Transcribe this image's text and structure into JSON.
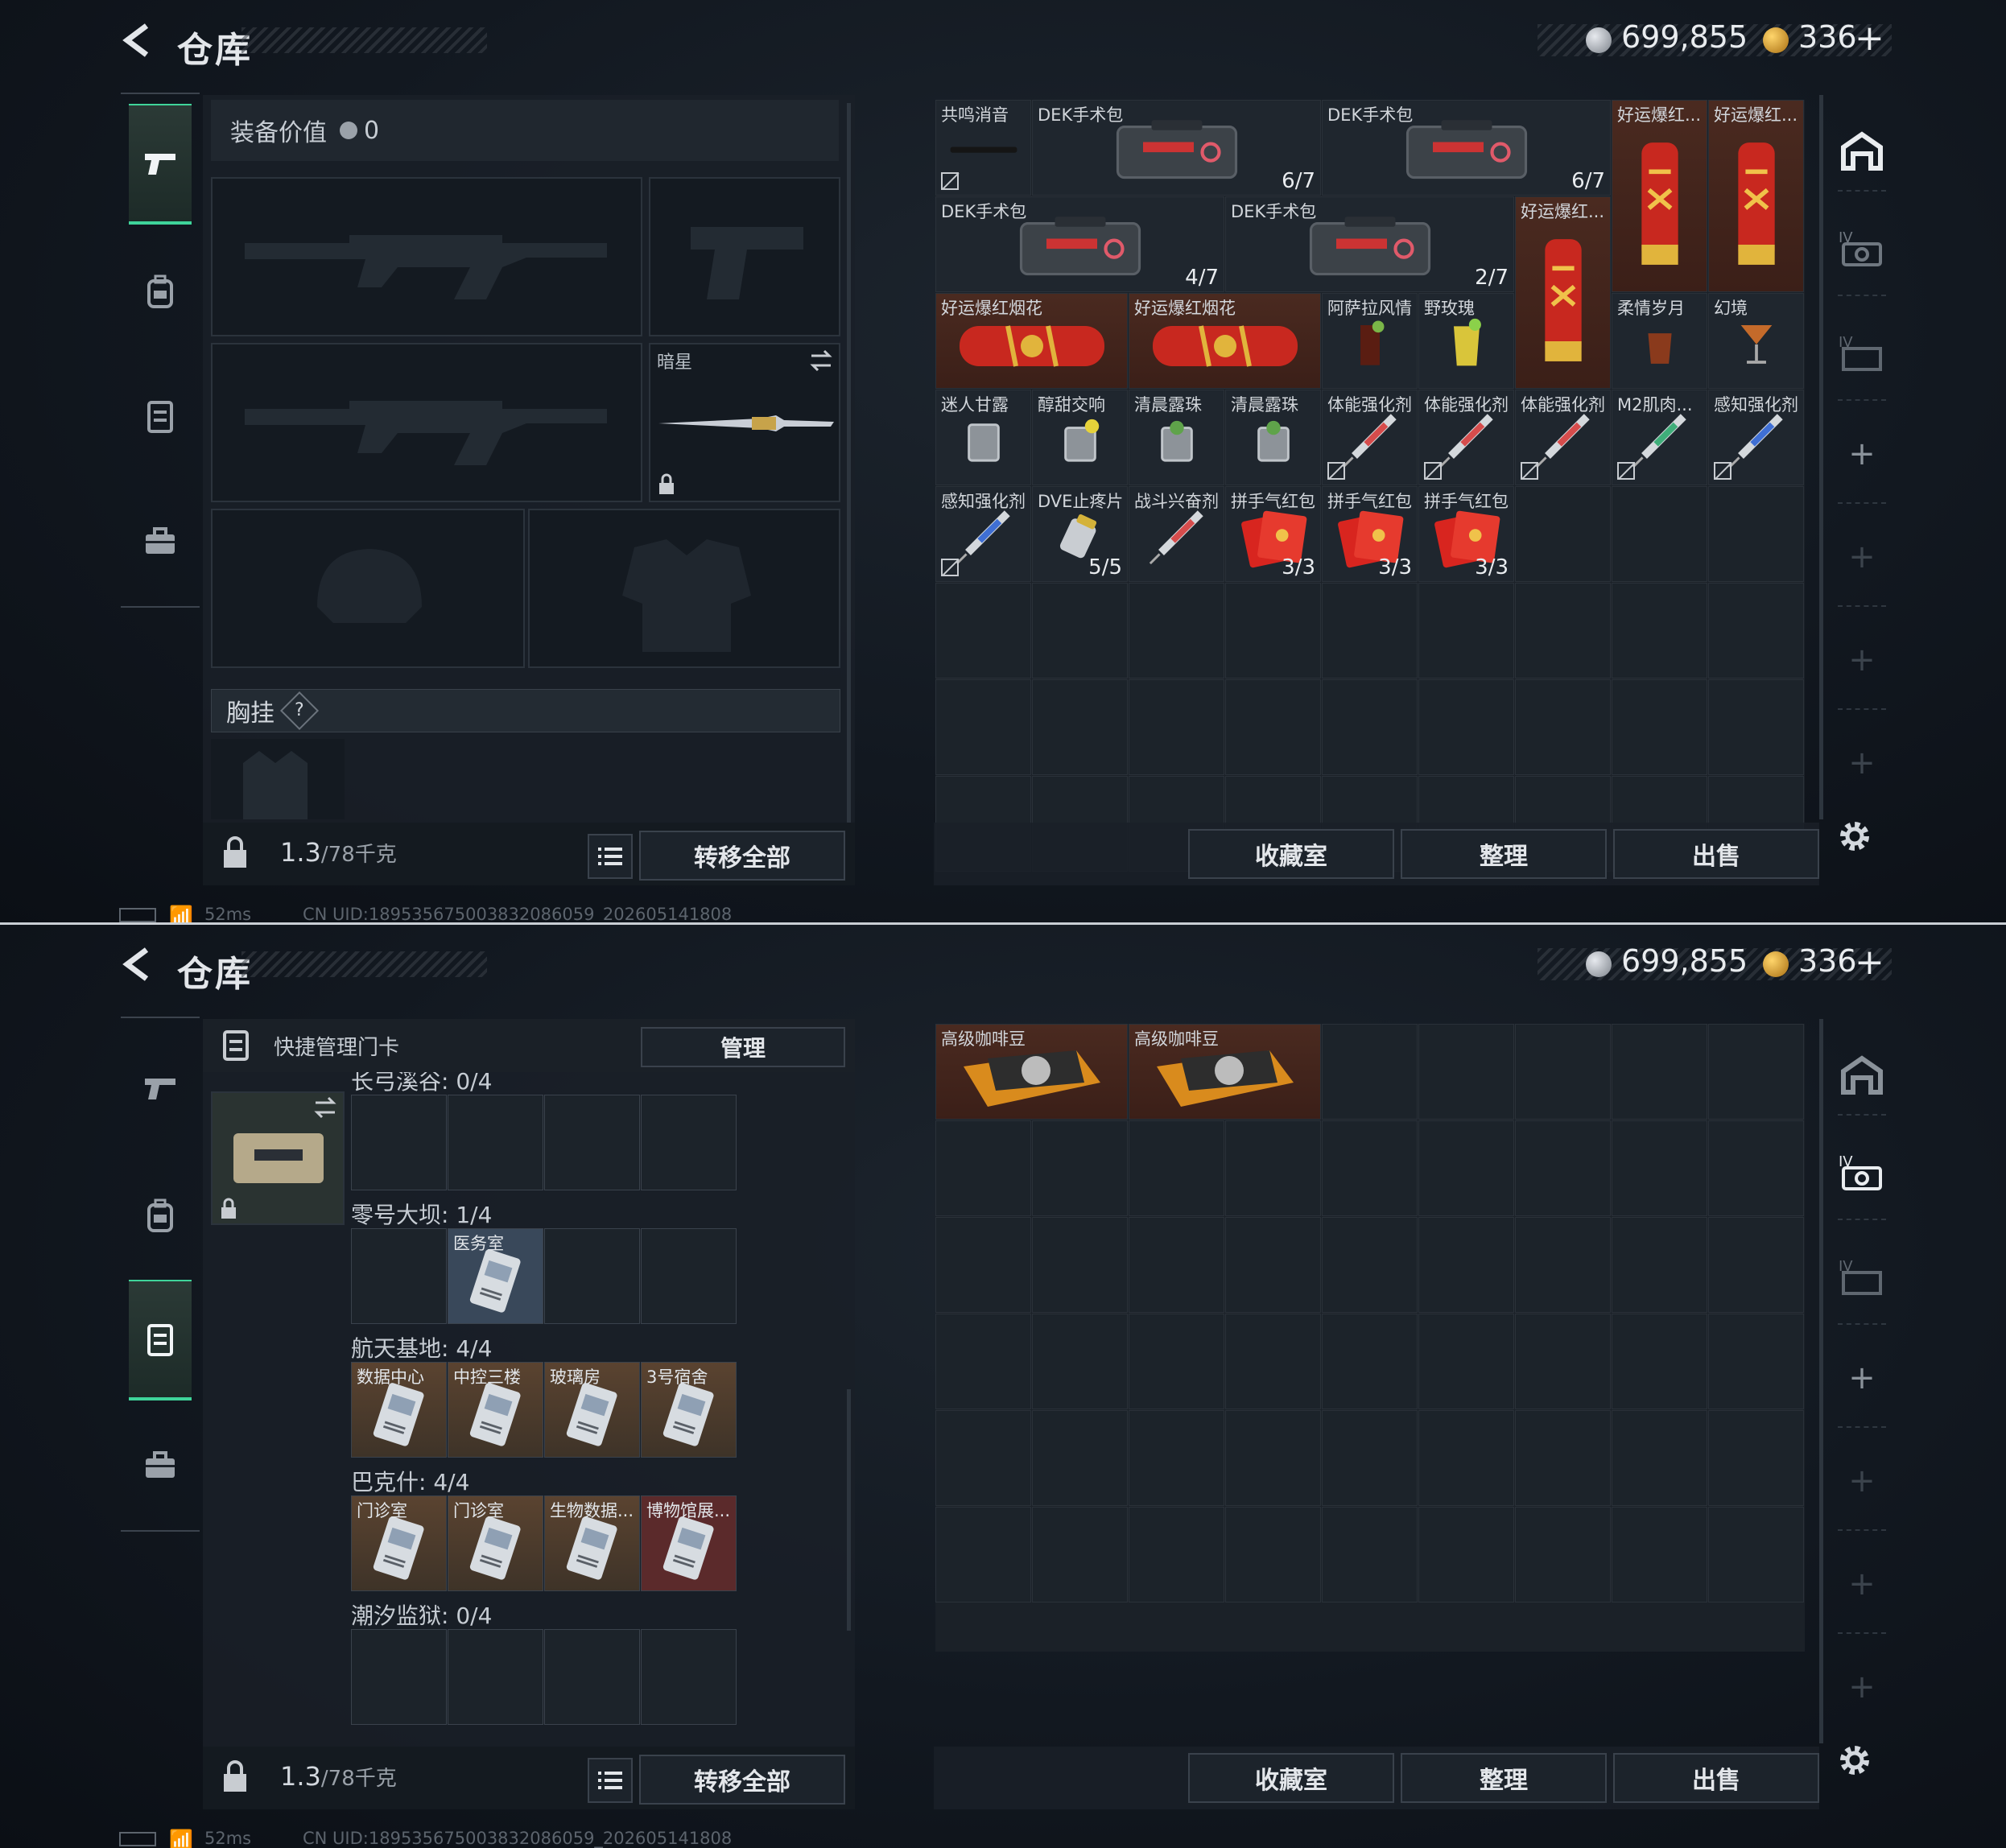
{
  "top": {
    "title": "仓库",
    "currency": {
      "silver": "699,855",
      "gold": "336"
    },
    "left_panel": {
      "equipment_value_label": "装备价值",
      "equipment_value": "0",
      "melee_slot_name": "暗星",
      "chest_rig_label": "胸挂",
      "help_mark": "?",
      "weight_current": "1.3",
      "weight_max": "/78千克",
      "transfer_all": "转移全部"
    },
    "grid_items": [
      {
        "name": "共鸣消音"
      },
      {
        "name": "DEK手术包",
        "count": "6/7"
      },
      {
        "name": "DEK手术包",
        "count": "6/7"
      },
      {
        "name": "好运爆红..."
      },
      {
        "name": "好运爆红..."
      },
      {
        "name": "DEK手术包",
        "count": "4/7"
      },
      {
        "name": "DEK手术包",
        "count": "2/7"
      },
      {
        "name": "好运爆红..."
      },
      {
        "name": "好运爆红烟花"
      },
      {
        "name": "好运爆红烟花"
      },
      {
        "name": "阿萨拉风情"
      },
      {
        "name": "野玫瑰"
      },
      {
        "name": "柔情岁月"
      },
      {
        "name": "幻境"
      },
      {
        "name": "迷人甘露"
      },
      {
        "name": "醇甜交响"
      },
      {
        "name": "清晨露珠"
      },
      {
        "name": "清晨露珠"
      },
      {
        "name": "体能强化剂"
      },
      {
        "name": "体能强化剂"
      },
      {
        "name": "体能强化剂"
      },
      {
        "name": "M2肌肉..."
      },
      {
        "name": "感知强化剂"
      },
      {
        "name": "感知强化剂"
      },
      {
        "name": "DVE止疼片",
        "count": "5/5"
      },
      {
        "name": "战斗兴奋剂"
      },
      {
        "name": "拼手气红包",
        "count": "3/3"
      },
      {
        "name": "拼手气红包",
        "count": "3/3"
      },
      {
        "name": "拼手气红包",
        "count": "3/3"
      }
    ],
    "buttons": {
      "collection": "收藏室",
      "sort": "整理",
      "sell": "出售"
    },
    "status": {
      "ping": "52ms",
      "uid": "CN UID:189535675003832086059_202605141808"
    }
  },
  "bottom": {
    "title": "仓库",
    "currency": {
      "silver": "699,855",
      "gold": "336"
    },
    "left_panel": {
      "header": "快捷管理门卡",
      "manage": "管理",
      "groups": [
        {
          "label": "长弓溪谷: 0/4",
          "cards": []
        },
        {
          "label": "零号大坝: 1/4",
          "cards": [
            {
              "pos": 1,
              "name": "医务室"
            }
          ]
        },
        {
          "label": "航天基地: 4/4",
          "cards": [
            {
              "pos": 0,
              "name": "数据中心"
            },
            {
              "pos": 1,
              "name": "中控三楼"
            },
            {
              "pos": 2,
              "name": "玻璃房"
            },
            {
              "pos": 3,
              "name": "3号宿舍"
            }
          ]
        },
        {
          "label": "巴克什: 4/4",
          "cards": [
            {
              "pos": 0,
              "name": "门诊室"
            },
            {
              "pos": 1,
              "name": "门诊室"
            },
            {
              "pos": 2,
              "name": "生物数据..."
            },
            {
              "pos": 3,
              "name": "博物馆展..."
            }
          ]
        },
        {
          "label": "潮汐监狱: 0/4",
          "cards": []
        }
      ],
      "weight_current": "1.3",
      "weight_max": "/78千克",
      "transfer_all": "转移全部"
    },
    "grid_items": [
      {
        "name": "高级咖啡豆"
      },
      {
        "name": "高级咖啡豆"
      }
    ],
    "buttons": {
      "collection": "收藏室",
      "sort": "整理",
      "sell": "出售"
    },
    "status": {
      "ping": "52ms",
      "uid": "CN UID:189535675003832086059_202605141808"
    }
  }
}
